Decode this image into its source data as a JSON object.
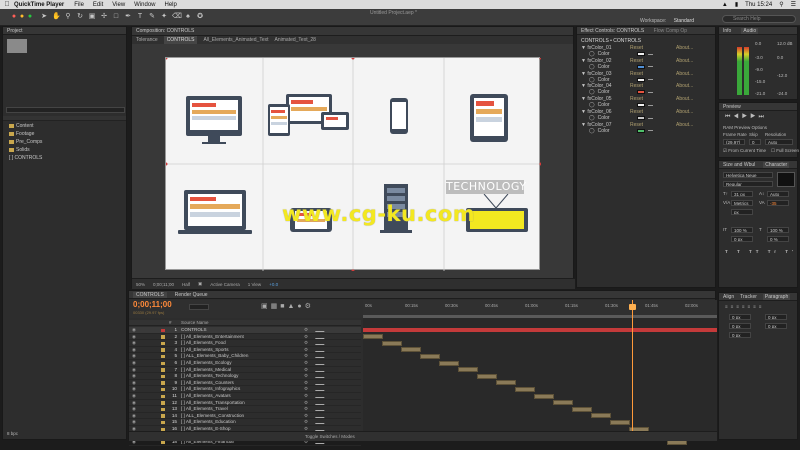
{
  "menubar": {
    "app_name": "QuickTime Player",
    "items": [
      "File",
      "Edit",
      "View",
      "Window",
      "Help"
    ],
    "clock": "Thu 15:24"
  },
  "ae": {
    "document_title": "Untitled Project.aep *",
    "workspace_label": "Workspace:",
    "workspace_value": "Standard",
    "search_placeholder": "Search Help"
  },
  "project": {
    "tab": "Project",
    "items": [
      {
        "label": "Content",
        "kind": "folder"
      },
      {
        "label": "Footage",
        "kind": "folder"
      },
      {
        "label": "Pre_Comps",
        "kind": "folder"
      },
      {
        "label": "Solids",
        "kind": "folder"
      },
      {
        "label": "[ ] CONTROLS",
        "kind": "comp"
      }
    ],
    "bpc": "8 bpc"
  },
  "composition": {
    "tab": "Composition: CONTROLS",
    "breadcrumbs": [
      "Tolerance",
      "CONTROLS",
      "All_Elements_Animated_Text",
      "Animated_Text_28"
    ],
    "center_label": "TECHNOLOGY",
    "footer": {
      "zoom": "50%",
      "timecode": "0;00;11;00",
      "resolution": "Half",
      "camera": "Active Camera",
      "views": "1 View",
      "exposure": "+0.0"
    }
  },
  "watermark": "www.cg-ku.com",
  "effects": {
    "tab": "Effect Controls: CONTROLS",
    "tab2": "Flow Comp Op",
    "header": "CONTROLS • CONTROLS",
    "rows": [
      {
        "name": "Color_01",
        "color": "#f0f0f0"
      },
      {
        "name": "Color_02",
        "color": "#4f8fd6"
      },
      {
        "name": "Color_03",
        "color": "#f0f0f0"
      },
      {
        "name": "Color_04",
        "color": "#e5533f"
      },
      {
        "name": "Color_05",
        "color": "#f0f0f0"
      },
      {
        "name": "Color_06",
        "color": "#c8c8c8"
      },
      {
        "name": "Color_07",
        "color": "#4fbf6a"
      }
    ],
    "reset_label": "Reset",
    "about_label": "About...",
    "color_label": "Color"
  },
  "info": {
    "tabs": [
      "Info",
      "Audio"
    ],
    "left_levels": [
      "0.0",
      "-6.0",
      "-12.0",
      "-18.0",
      "-24.0"
    ],
    "right_levels": [
      "12.0 dB",
      "0.0",
      "-12.0",
      "-24.0"
    ],
    "db_levels": [
      "-3.0",
      "-9.0",
      "-15.0",
      "-21.0"
    ]
  },
  "preview": {
    "tab": "Preview",
    "ram_options": "RAM Preview Options",
    "frame_rate_label": "Frame Rate",
    "skip_label": "Skip",
    "resolution_label": "Resolution",
    "frame_rate": "(29.97)",
    "skip": "0",
    "resolution": "Auto",
    "from_current": "From Current Time",
    "full_screen": "Full Screen"
  },
  "character": {
    "tabs": [
      "Size and Wbul",
      "Character"
    ],
    "font": "Helvetica Neue",
    "style": "Regular",
    "size": "31 px",
    "leading": "Auto",
    "kerning": "Metrics",
    "tracking": "-35",
    "unit": "px",
    "v_scale": "100 %",
    "h_scale": "100 %",
    "baseline": "0 px",
    "tsume": "0 %"
  },
  "paragraph": {
    "tabs": [
      "Align",
      "Tracker",
      "Paragraph"
    ],
    "values": [
      "0 px",
      "0 px",
      "0 px",
      "0 px",
      "0 px"
    ]
  },
  "timeline": {
    "tabs": [
      "CONTROLS",
      "Render Queue"
    ],
    "timecode": "0;00;11;00",
    "fps": "00330 (29.97 fps)",
    "header_cols": [
      "#",
      "Source Name"
    ],
    "ruler": [
      "00s",
      "00:15s",
      "00:30s",
      "00:45s",
      "01:00s",
      "01:15s",
      "01:30s",
      "01:45s",
      "02:00s"
    ],
    "footer": "Toggle Switches / Modes",
    "layers": [
      {
        "num": "1",
        "name": "CONTROLS",
        "label": "#c43a3a"
      },
      {
        "num": "2",
        "name": "[ ] All_Elements_Entertainment",
        "label": "#c9a74d"
      },
      {
        "num": "3",
        "name": "[ ] All_Elements_Food",
        "label": "#c9a74d"
      },
      {
        "num": "4",
        "name": "[ ] All_Elements_Sports",
        "label": "#c9a74d"
      },
      {
        "num": "5",
        "name": "[ ] ALL_Elements_Baby_Children",
        "label": "#c9a74d"
      },
      {
        "num": "6",
        "name": "[ ] All_Elements_Ecology",
        "label": "#c9a74d"
      },
      {
        "num": "7",
        "name": "[ ] All_Elements_Medical",
        "label": "#c9a74d"
      },
      {
        "num": "8",
        "name": "[ ] All_Elements_Technology",
        "label": "#c9a74d"
      },
      {
        "num": "9",
        "name": "[ ] All_Elements_Counters",
        "label": "#c9a74d"
      },
      {
        "num": "10",
        "name": "[ ] All_Elements_Infographics",
        "label": "#c9a74d"
      },
      {
        "num": "11",
        "name": "[ ] All_Elements_Avatars",
        "label": "#c9a74d"
      },
      {
        "num": "12",
        "name": "[ ] All_Elements_Transportation",
        "label": "#c9a74d"
      },
      {
        "num": "13",
        "name": "[ ] All_Elements_Travel",
        "label": "#c9a74d"
      },
      {
        "num": "14",
        "name": "[ ] ALL_Elements_Construction",
        "label": "#c9a74d"
      },
      {
        "num": "15",
        "name": "[ ] All_Elements_Education",
        "label": "#c9a74d"
      },
      {
        "num": "16",
        "name": "[ ] All_Elements_E-Shop",
        "label": "#c9a74d"
      },
      {
        "num": "17",
        "name": "[ ] All_Elements_Graphic_Design",
        "label": "#c9a74d"
      },
      {
        "num": "18",
        "name": "[ ] All_Elements_Financial",
        "label": "#c9a74d"
      }
    ]
  },
  "colors": {
    "timecode": "#ff8a3a",
    "watermark": "#f3e820",
    "layer_bar": "#8a7a58",
    "red_layer": "#c43a3a"
  }
}
